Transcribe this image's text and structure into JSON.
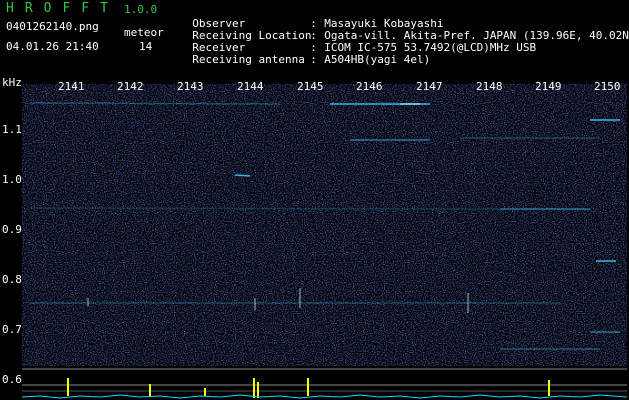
{
  "app": {
    "title": "HROFFT",
    "version": "1.0.0"
  },
  "file": {
    "name": "0401262140.png",
    "timestamp": "04.01.26 21:40"
  },
  "meteor": {
    "label": "meteor",
    "count": "14"
  },
  "info": [
    {
      "key": "Observer",
      "sep": ":",
      "value": "Masayuki Kobayashi"
    },
    {
      "key": "Receiving Location",
      "sep": ":",
      "value": "Ogata-vill. Akita-Pref. JAPAN (139.96E, 40.02N)"
    },
    {
      "key": "Receiver",
      "sep": ":",
      "value": "ICOM IC-575 53.7492(@LCD)MHz USB"
    },
    {
      "key": "Receiving antenna",
      "sep": ":",
      "value": "A504HB(yagi 4el)"
    }
  ],
  "axes": {
    "unit": "kHz",
    "time_ticks": [
      "2141",
      "2142",
      "2143",
      "2144",
      "2145",
      "2146",
      "2147",
      "2148",
      "2149",
      "2150"
    ],
    "freq_ticks": [
      "1.1",
      "1.0",
      "0.9",
      "0.8",
      "0.7",
      "0.6"
    ]
  },
  "colors": {
    "background": "#000000",
    "noise": "#1a2a9a",
    "echo": "#40d0ff",
    "signal": "#ffff00",
    "baseline": "#00e0ff",
    "title": "#34c24a"
  }
}
